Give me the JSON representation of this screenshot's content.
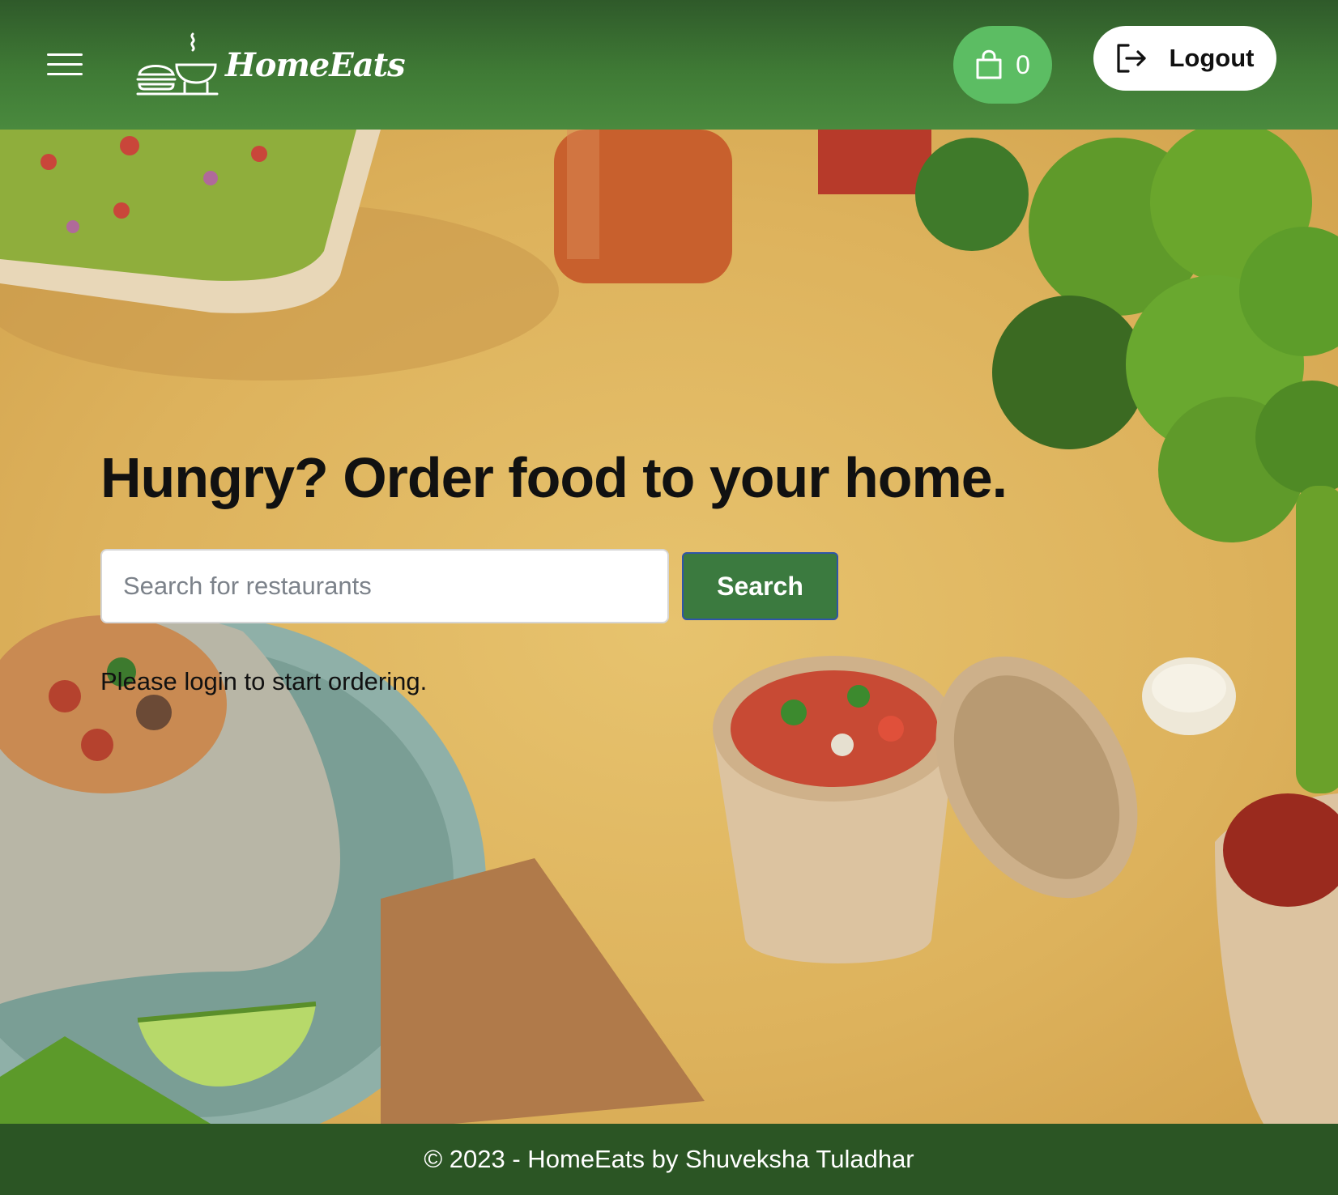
{
  "header": {
    "brand_name": "HomeEats",
    "cart_count": "0",
    "logout_label": "Logout"
  },
  "hero": {
    "title": "Hungry? Order food to your home.",
    "search_placeholder": "Search for restaurants",
    "search_button": "Search",
    "login_message": "Please login to start ordering."
  },
  "footer": {
    "text": "© 2023 - HomeEats by Shuveksha Tuladhar"
  },
  "colors": {
    "header_green": "#3f7a35",
    "cart_green": "#5cbd63",
    "search_button": "#3b7a3f",
    "footer_green": "#2b5524"
  },
  "icons": [
    "menu-icon",
    "logo-icon",
    "shopping-bag-icon",
    "logout-icon"
  ]
}
